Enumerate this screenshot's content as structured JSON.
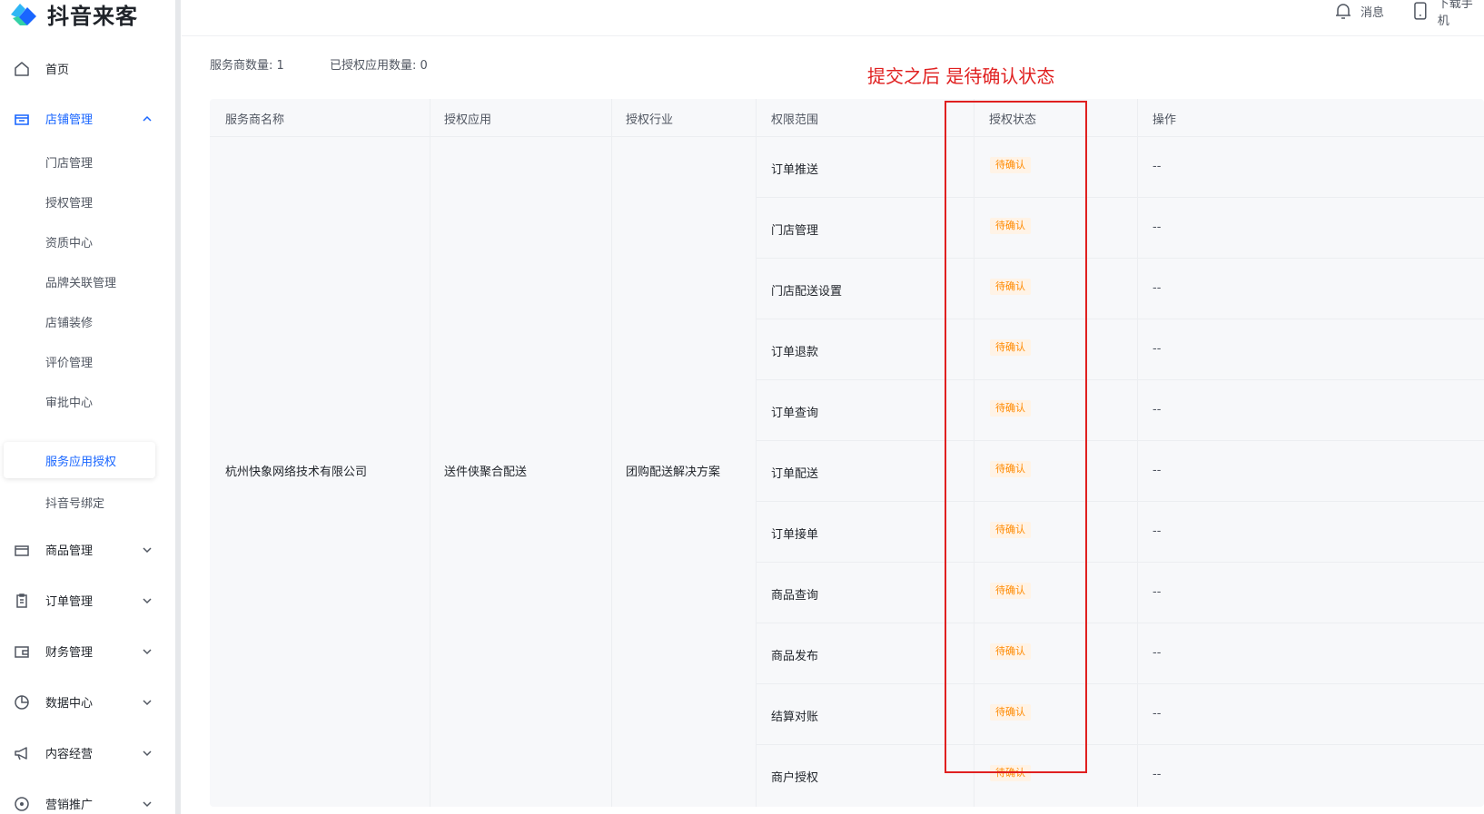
{
  "logo": {
    "text": "抖音来客"
  },
  "topbar": {
    "message_label": "消息",
    "download_label": "下载手机"
  },
  "sidebar": {
    "home": "首页",
    "store_mgmt": "店铺管理",
    "sub_items": [
      "门店管理",
      "授权管理",
      "资质中心",
      "品牌关联管理",
      "店铺装修",
      "评价管理",
      "审批中心",
      "服务应用授权",
      "抖音号绑定"
    ],
    "groups": [
      "商品管理",
      "订单管理",
      "财务管理",
      "数据中心",
      "内容经营",
      "营销推广"
    ]
  },
  "summary": {
    "provider_count": "服务商数量: 1",
    "authorized_app_count": "已授权应用数量: 0"
  },
  "annotation": "提交之后 是待确认状态",
  "table": {
    "headers": [
      "服务商名称",
      "授权应用",
      "授权行业",
      "权限范围",
      "授权状态",
      "操作"
    ],
    "provider": "杭州快象网络技术有限公司",
    "app": "送件侠聚合配送",
    "industry": "团购配送解决方案",
    "rows": [
      {
        "scope": "订单推送",
        "status": "待确认",
        "op": "--"
      },
      {
        "scope": "门店管理",
        "status": "待确认",
        "op": "--"
      },
      {
        "scope": "门店配送设置",
        "status": "待确认",
        "op": "--"
      },
      {
        "scope": "订单退款",
        "status": "待确认",
        "op": "--"
      },
      {
        "scope": "订单查询",
        "status": "待确认",
        "op": "--"
      },
      {
        "scope": "订单配送",
        "status": "待确认",
        "op": "--"
      },
      {
        "scope": "订单接单",
        "status": "待确认",
        "op": "--"
      },
      {
        "scope": "商品查询",
        "status": "待确认",
        "op": "--"
      },
      {
        "scope": "商品发布",
        "status": "待确认",
        "op": "--"
      },
      {
        "scope": "结算对账",
        "status": "待确认",
        "op": "--"
      },
      {
        "scope": "商户授权",
        "status": "待确认",
        "op": "--"
      }
    ]
  },
  "colors": {
    "accent": "#1966ff",
    "status_text": "#ff8a00",
    "status_bg": "#fff3e6",
    "annotation": "#e02020"
  }
}
